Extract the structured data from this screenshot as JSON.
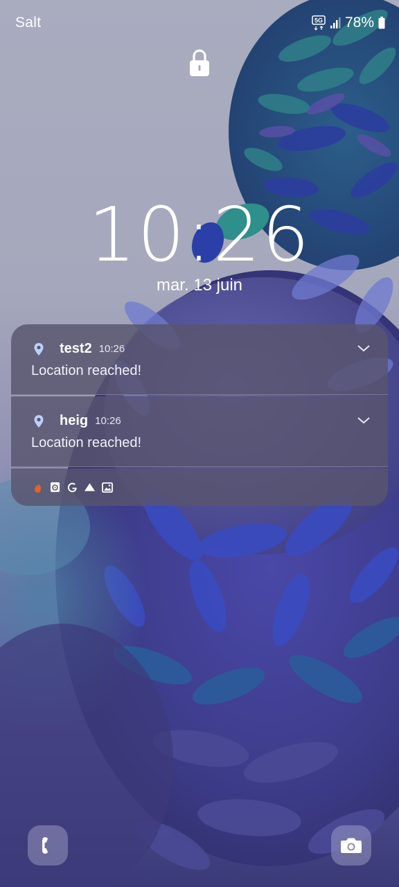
{
  "status_bar": {
    "carrier": "Salt",
    "network_badge": "5G",
    "battery_percent": "78%",
    "icons": [
      "5g-data-icon",
      "signal-icon",
      "battery-icon"
    ]
  },
  "lock_screen": {
    "time": "10:26",
    "date": "mar. 13 juin",
    "lock_icon": "lock-icon"
  },
  "notifications": [
    {
      "app": "test2",
      "time": "10:26",
      "text": "Location reached!",
      "icon": "location-pin-icon"
    },
    {
      "app": "heig",
      "time": "10:26",
      "text": "Location reached!",
      "icon": "location-pin-icon"
    }
  ],
  "notification_icons": [
    "flame-app-icon",
    "device-care-icon",
    "google-icon",
    "drive-icon",
    "gallery-icon"
  ],
  "shortcuts": {
    "left": "phone-icon",
    "right": "camera-icon"
  },
  "colors": {
    "notification_bg": "#58546e",
    "accent_orange": "#e0632c",
    "text": "#ffffff"
  }
}
